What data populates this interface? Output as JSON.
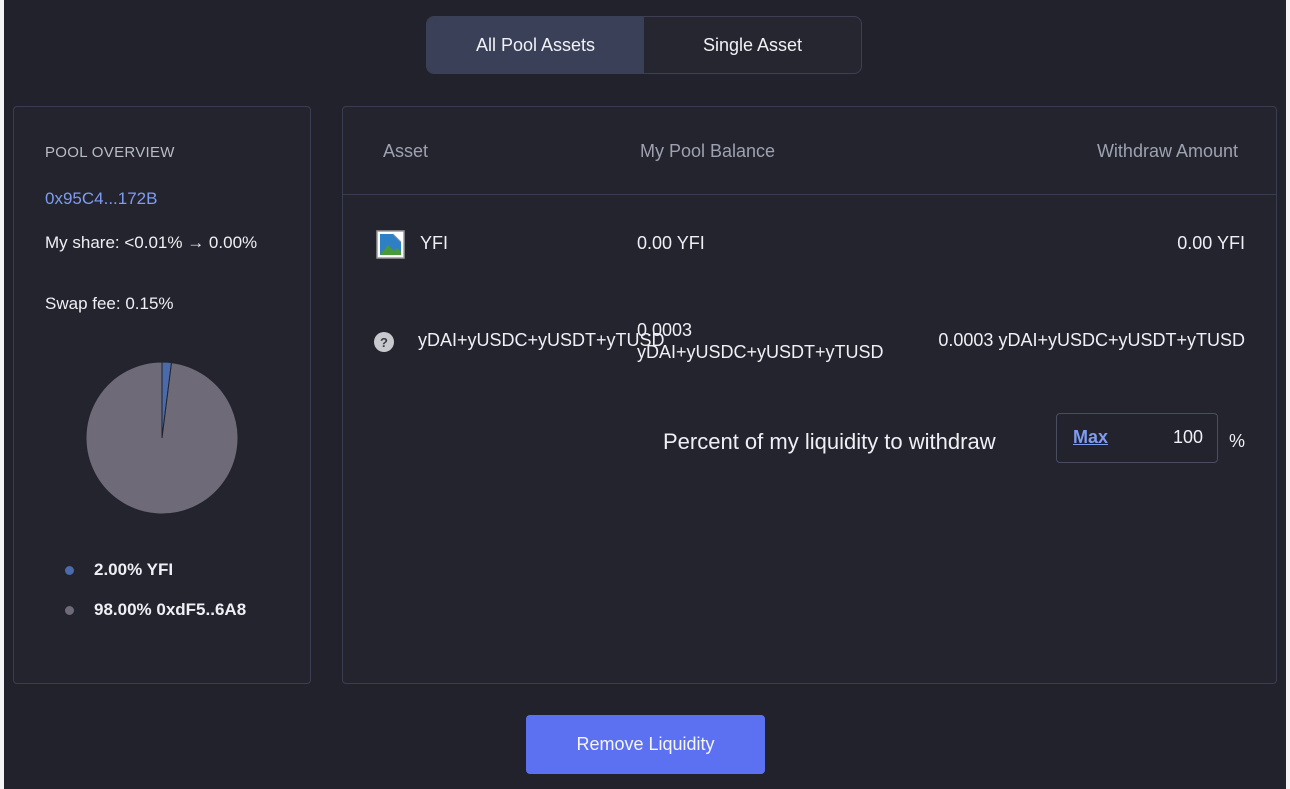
{
  "tabs": [
    {
      "label": "All Pool Assets",
      "active": true
    },
    {
      "label": "Single Asset",
      "active": false
    }
  ],
  "pool_overview": {
    "title": "POOL OVERVIEW",
    "address": "0x95C4...172B",
    "my_share": "My share: <0.01% → 0.00%",
    "swap_fee": "Swap fee: 0.15%",
    "legend": [
      {
        "label": "2.00% YFI",
        "color": "#4a6aa9"
      },
      {
        "label": "98.00% 0xdF5..6A8",
        "color": "#6e6a78"
      }
    ]
  },
  "chart_data": {
    "type": "pie",
    "slices": [
      {
        "label": "YFI",
        "value": 2.0,
        "color": "#4a6aa9"
      },
      {
        "label": "0xdF5..6A8",
        "value": 98.0,
        "color": "#6e6a78"
      }
    ]
  },
  "table": {
    "headers": {
      "asset": "Asset",
      "balance": "My Pool Balance",
      "withdraw": "Withdraw Amount"
    },
    "rows": [
      {
        "icon": "broken-image-icon",
        "asset": "YFI",
        "balance": "0.00 YFI",
        "withdraw": "0.00 YFI"
      },
      {
        "icon": "question-mark-icon",
        "asset": "yDAI+yUSDC+yUSDT+yTUSD",
        "balance": "0.0003 yDAI+yUSDC+yUSDT+yTUSD",
        "withdraw": "0.0003 yDAI+yUSDC+yUSDT+yTUSD"
      }
    ]
  },
  "withdraw_percent": {
    "label": "Percent of my liquidity to withdraw",
    "max_label": "Max",
    "value": "100",
    "unit": "%"
  },
  "actions": {
    "remove_label": "Remove Liquidity"
  },
  "colors": {
    "accent": "#5b71f2",
    "link": "#7f9cf3",
    "background": "#21222b"
  }
}
